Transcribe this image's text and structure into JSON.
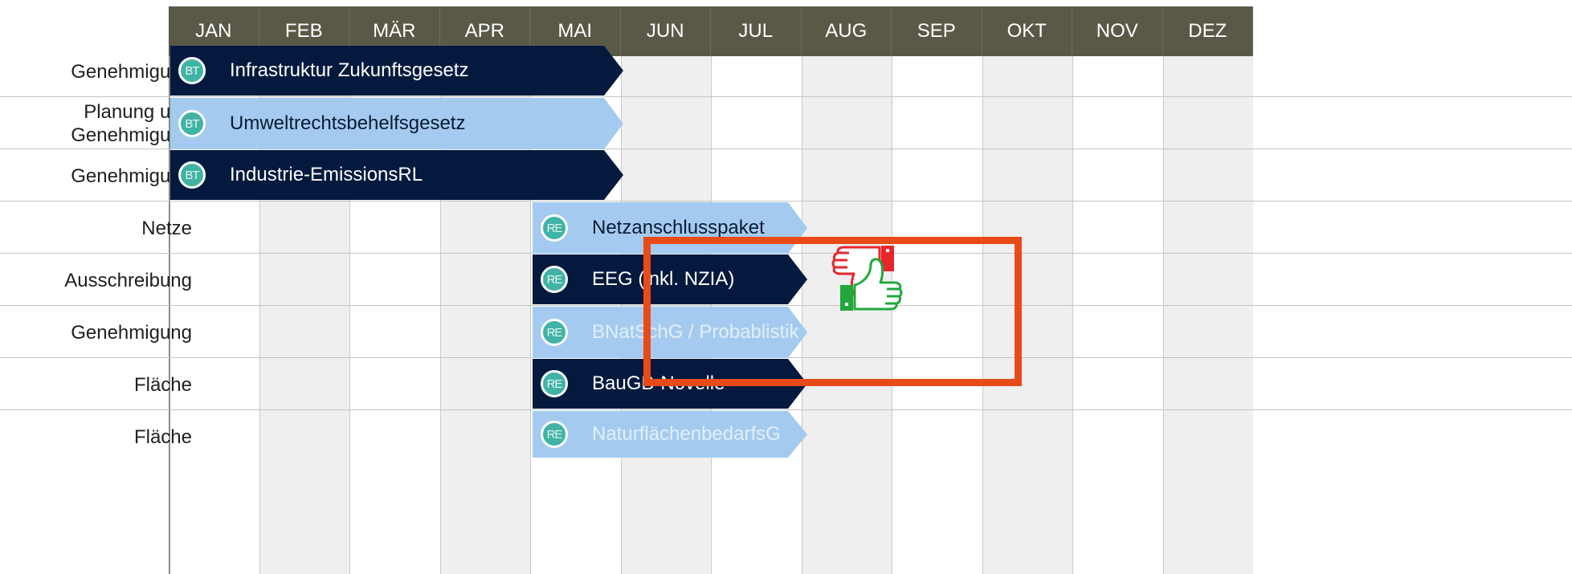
{
  "months": [
    "JAN",
    "FEB",
    "MÄR",
    "APR",
    "MAI",
    "JUN",
    "JUL",
    "AUG",
    "SEP",
    "OKT",
    "NOV",
    "DEZ"
  ],
  "rows": [
    {
      "category": "Genehmigung",
      "badge": "BT",
      "label": "Infrastruktur Zukunftsgesetz",
      "style": "dark"
    },
    {
      "category": "Planung und\nGenehmigung",
      "badge": "BT",
      "label": "Umweltrechtsbehelfsgesetz",
      "style": "light"
    },
    {
      "category": "Genehmigung",
      "badge": "BT",
      "label": "Industrie-EmissionsRL",
      "style": "dark"
    },
    {
      "category": "Netze",
      "badge": "RE",
      "label": "Netzanschlusspaket",
      "style": "light"
    },
    {
      "category": "Ausschreibung",
      "badge": "RE",
      "label": "EEG (inkl. NZIA)",
      "style": "dark"
    },
    {
      "category": "Genehmigung",
      "badge": "RE",
      "label": "BNatSchG / Probablistik",
      "style": "light-faded"
    },
    {
      "category": "Fläche",
      "badge": "RE",
      "label": "BauGB-Novelle",
      "style": "dark"
    },
    {
      "category": "Fläche",
      "badge": "RE",
      "label": "NaturflächenbedarfsG",
      "style": "light-faded"
    }
  ],
  "icons": {
    "thumbs_down": "thumbs-down-icon",
    "thumbs_up": "thumbs-up-icon"
  },
  "colors": {
    "header": "#5a5948",
    "dark_bar": "#031a3e",
    "light_bar": "#a4cbef",
    "badge": "#41b3a6",
    "highlight": "#e84b18",
    "thumbs_down": "#e8262b",
    "thumbs_up": "#22a83a"
  }
}
